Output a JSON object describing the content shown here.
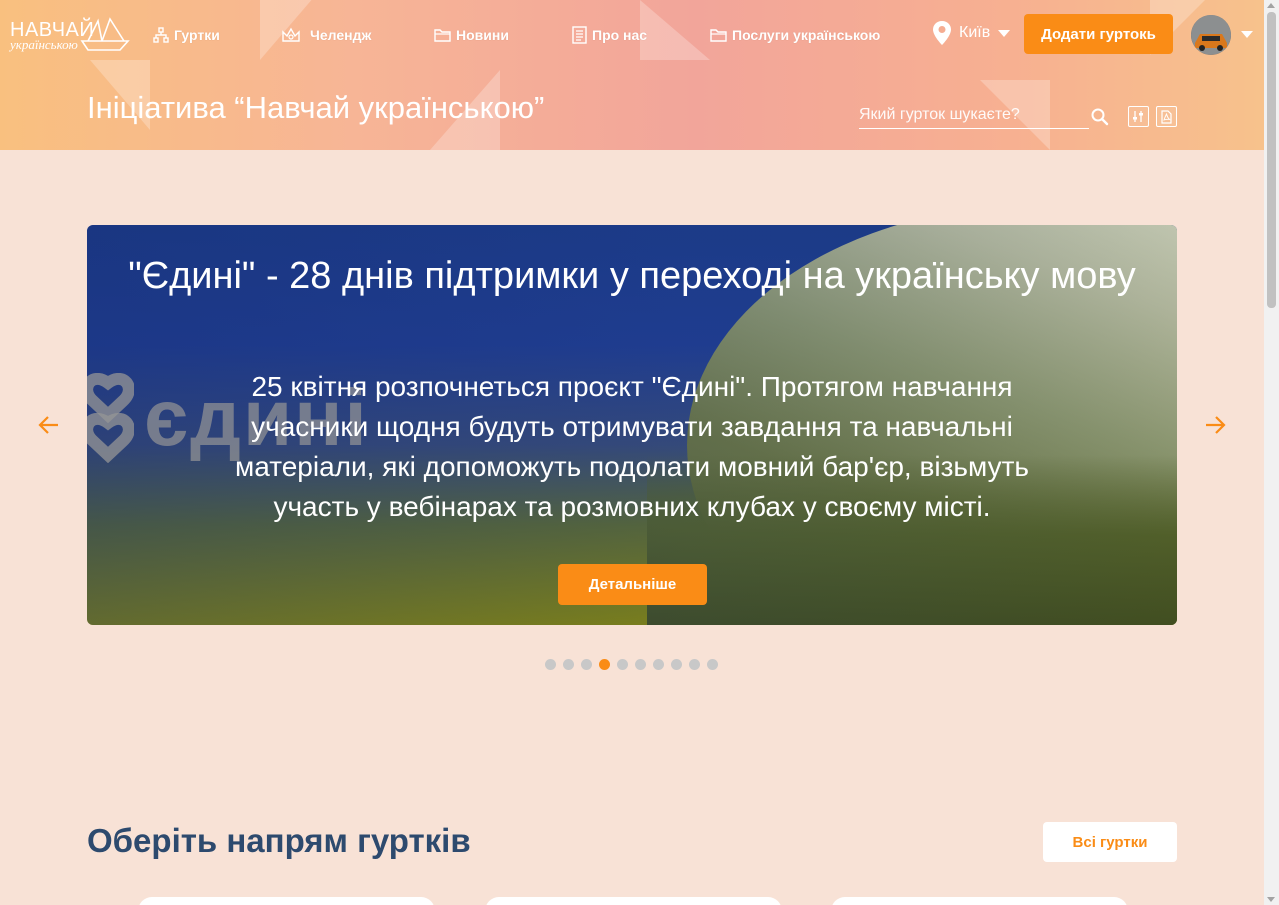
{
  "logo": {
    "word1": "НАВЧАЙ",
    "word2": "українською"
  },
  "nav": [
    {
      "label": "Гуртки",
      "icon": "sitemap-icon"
    },
    {
      "label": "Челендж",
      "icon": "crown-icon"
    },
    {
      "label": "Новини",
      "icon": "folder-icon"
    },
    {
      "label": "Про нас",
      "icon": "document-icon"
    },
    {
      "label": "Послуги українською",
      "icon": "folder-icon"
    }
  ],
  "city": {
    "label": "Київ",
    "icon": "location-pin-icon"
  },
  "header": {
    "add_button": "Додати гуртокь",
    "title": "Ініціатива “Навчай українською”",
    "search_placeholder": "Який гурток шукаєте?"
  },
  "carousel": {
    "slide_title": "\"Єдині\" - 28 днів підтримки у переході на українську мову",
    "slide_logo_text": "єдині",
    "slide_text": "25 квітня розпочнеться проєкт \"Єдині\". Протягом навчання учасники щодня будуть отримувати завдання та навчальні матеріали, які допоможуть подолати мовний бар'єр, візьмуть участь у вебінарах та розмовних клубах у своєму місті.",
    "button": "Детальніше",
    "dot_count": 10,
    "active_dot": 4
  },
  "directions": {
    "title": "Оберіть напрям гуртків",
    "all_button": "Всі гуртки"
  },
  "colors": {
    "accent": "#fa8c16",
    "heading": "#2d4a6e",
    "background": "#f8e2d6"
  }
}
